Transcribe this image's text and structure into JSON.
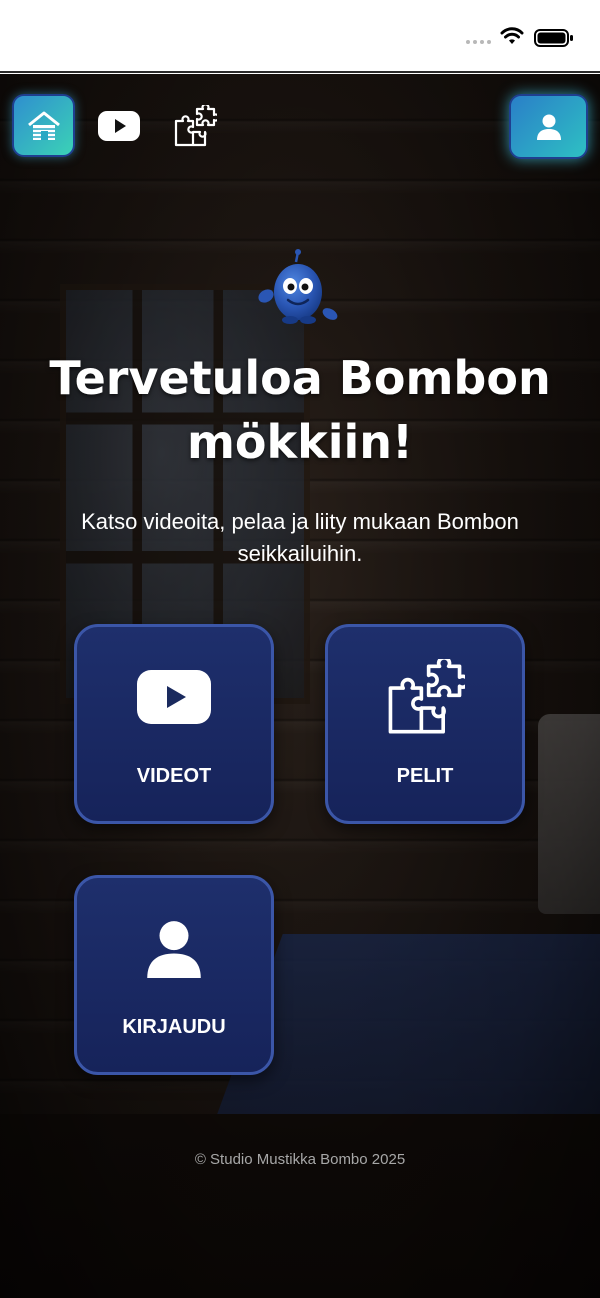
{
  "status_bar": {
    "icons": [
      "signal-dots-icon",
      "wifi-icon",
      "battery-icon"
    ]
  },
  "nav": {
    "home_icon": "cabin-home-icon",
    "videos_icon": "youtube-icon",
    "games_icon": "puzzle-icon",
    "profile_icon": "user-icon"
  },
  "hero": {
    "mascot": "bombo-mascot-icon",
    "title": "Tervetuloa Bombon mökkiin!",
    "subtitle": "Katso videoita, pelaa ja liity mukaan Bombon seikkailuihin."
  },
  "cards": [
    {
      "label": "VIDEOT",
      "icon": "youtube-icon"
    },
    {
      "label": "PELIT",
      "icon": "puzzle-icon"
    },
    {
      "label": "KIRJAUDU",
      "icon": "user-icon"
    }
  ],
  "footer": {
    "text": "© Studio Mustikka Bombo 2025"
  },
  "colors": {
    "card_bg": "#1e2f6c",
    "card_border": "#3b56a8",
    "accent_teal": "#3bd2b6",
    "accent_blue": "#2a7fc8"
  }
}
